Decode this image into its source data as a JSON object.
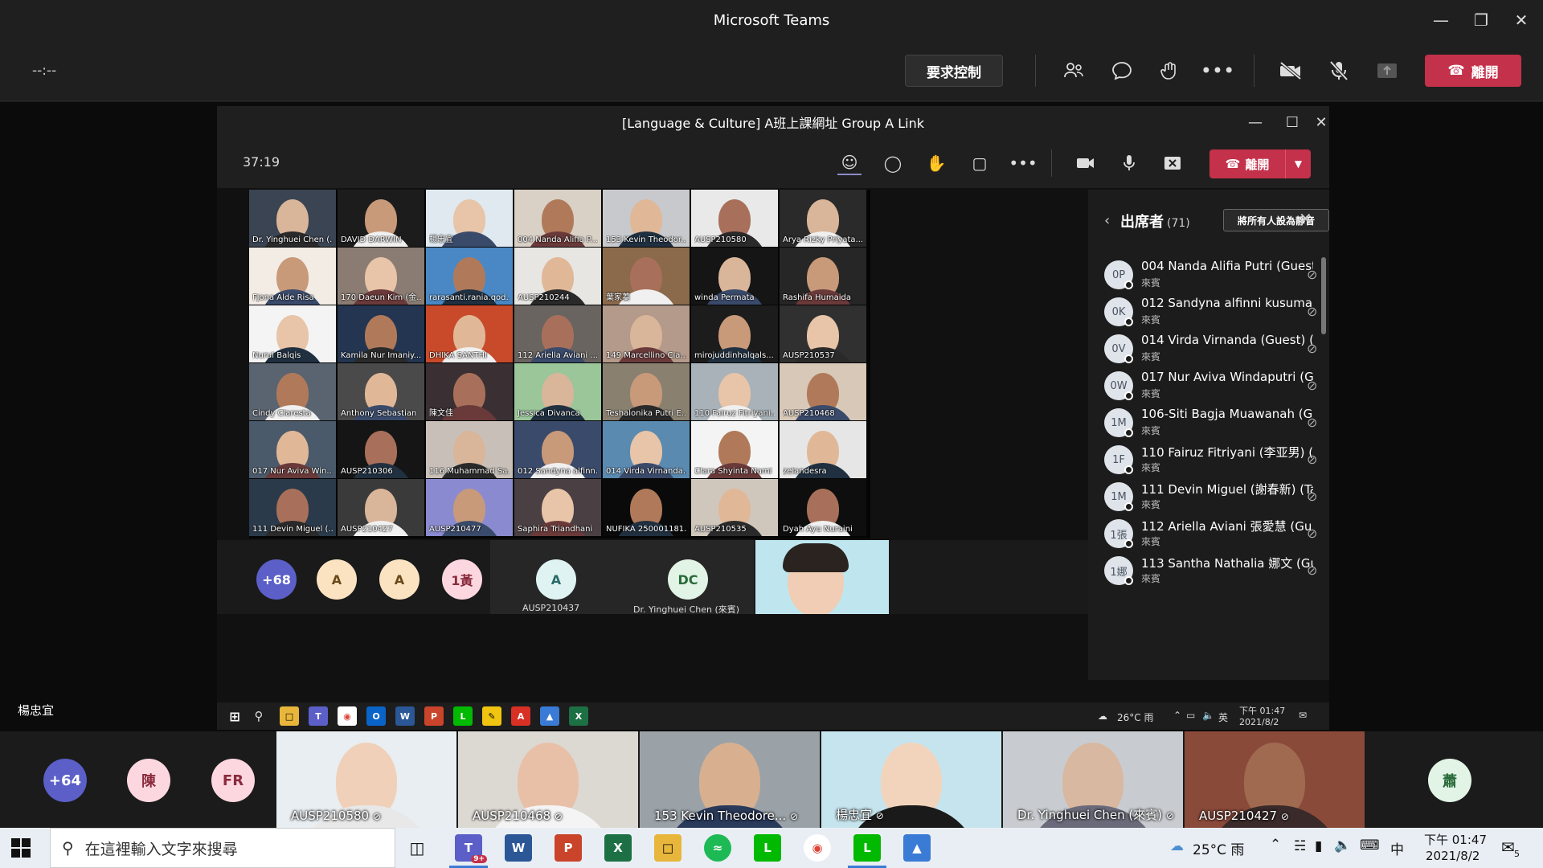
{
  "app_title": "Microsoft Teams",
  "outer_toolbar": {
    "timer": "--:--",
    "request_control": "要求控制",
    "leave": "離開"
  },
  "presenter_label": "楊忠宜",
  "inner_window": {
    "title": "[Language & Culture] A班上課網址 Group A Link",
    "timer": "37:19",
    "leave": "離開"
  },
  "gallery": [
    [
      "Dr. Yinghuei Chen (...",
      "DAVID DARWIN",
      "楊忠宜",
      "004 Nanda Alifia P...",
      "153 Kevin Theodor...",
      "AUSP210580",
      "Arya Rizky Priyata..."
    ],
    [
      "Fjona Alde Risa",
      "170 Daeun Kim (金...",
      "rarasanti.rania.qod...",
      "AUSP210244",
      "葉家蓁",
      "winda Permata",
      "Rashifa Humaida"
    ],
    [
      "Nurul Balqis",
      "Kamila Nur Imaniy...",
      "DHIKA SANTHI",
      "112 Ariella Aviani ...",
      "149 Marcellino Cla...",
      "mirojuddinhalqals...",
      "AUSP210537"
    ],
    [
      "Cindy Claresta",
      "Anthony Sebastian",
      "陳文佳",
      "Jessica Divanca",
      "Teshalonika Putri E...",
      "110 Fairuz Fitriyani...",
      "AUSP210468"
    ],
    [
      "017 Nur Aviva Win...",
      "AUSP210306",
      "116 Muhammad Sa...",
      "012 Sandyna alfinn...",
      "014 Virda Virnanda...",
      "Clara Shyinta Nami",
      "zelandesra"
    ],
    [
      "111 Devin Miguel (...",
      "AUSP210427",
      "AUSP210477",
      "Saphira Triandhani",
      "NUFIKA 250001181...",
      "AUSP210535",
      "Dyah Ayu Nuraini"
    ]
  ],
  "inner_strip": {
    "more": "+68",
    "avatars": [
      "A",
      "A",
      "1黃"
    ],
    "tile1_initial": "A",
    "tile1_name": "AUSP210437",
    "tile2_initial": "DC",
    "tile2_name": "Dr. Yinghuei Chen (來賓)"
  },
  "panel": {
    "title": "出席者",
    "count": "(71)",
    "mute_all": "將所有人設為靜音",
    "participants": [
      {
        "initials": "0P",
        "name": "004 Nanda Alifia Putri (Guest)...",
        "role": "來賓"
      },
      {
        "initials": "0K",
        "name": "012 Sandyna alfinni kusuma (...",
        "role": "來賓"
      },
      {
        "initials": "0V",
        "name": "014 Virda Virnanda (Guest) (...",
        "role": "來賓"
      },
      {
        "initials": "0W",
        "name": "017 Nur Aviva Windaputri (Gu...",
        "role": "來賓"
      },
      {
        "initials": "1M",
        "name": "106-Siti Bagja Muawanah (Gu...",
        "role": "來賓"
      },
      {
        "initials": "1F",
        "name": "110 Fairuz Fitriyani (李亚男) (...",
        "role": "來賓"
      },
      {
        "initials": "1M",
        "name": "111 Devin Miguel (謝春新) (Ta...",
        "role": "來賓"
      },
      {
        "initials": "1張",
        "name": "112 Ariella Aviani 張愛慧 (Gu...",
        "role": "來賓"
      },
      {
        "initials": "1娜",
        "name": "113 Santha Nathalia 娜文 (Gu...",
        "role": "來賓"
      }
    ]
  },
  "inner_taskbar": {
    "weather": "26°C 雨",
    "ime": "英",
    "time": "下午 01:47",
    "date": "2021/8/2"
  },
  "outer_strip": {
    "more": "+64",
    "avatar1": "陳",
    "avatar2": "FR",
    "avatar_right": "蕭",
    "tiles": [
      "AUSP210580",
      "AUSP210468",
      "153 Kevin Theodore...",
      "楊忠宜",
      "Dr. Yinghuei Chen (來賓)",
      "AUSP210427"
    ]
  },
  "taskbar": {
    "search_placeholder": "在這裡輸入文字來搜尋",
    "teams_badge": "9+",
    "weather": "25°C 雨",
    "ime": "中",
    "time": "下午 01:47",
    "date": "2021/8/2",
    "notif_count": "5"
  }
}
